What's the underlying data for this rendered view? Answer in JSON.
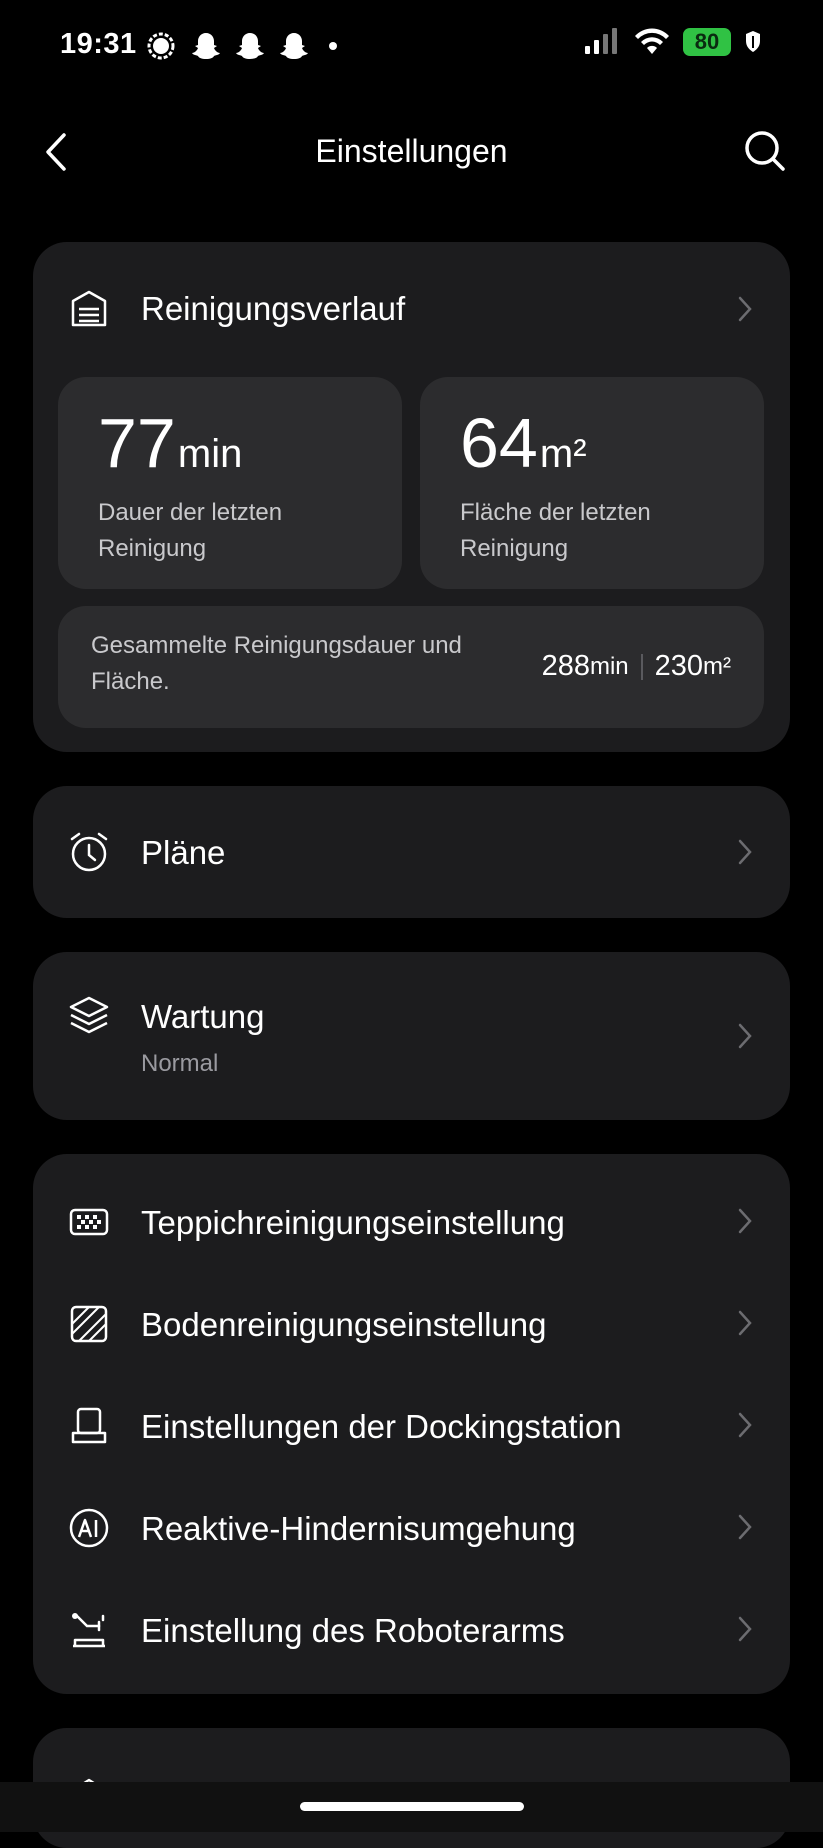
{
  "status_bar": {
    "time": "19:31",
    "battery": "80",
    "icons_left": [
      "signal-messenger-icon",
      "snapchat-icon",
      "snapchat-icon",
      "snapchat-icon",
      "dot-icon"
    ],
    "icons_right": [
      "cellular-signal-icon",
      "wifi-icon",
      "battery-icon",
      "shield-icon"
    ]
  },
  "header": {
    "title": "Einstellungen"
  },
  "history": {
    "title": "Reinigungsverlauf",
    "last_duration": {
      "value": "77",
      "unit": "min",
      "label": "Dauer der letzten Reinigung"
    },
    "last_area": {
      "value": "64",
      "unit": "m²",
      "label": "Fläche der letzten Reinigung"
    },
    "totals": {
      "label": "Gesammelte Reinigungsdauer und Fläche.",
      "duration_value": "288",
      "duration_unit": "min",
      "area_value": "230",
      "area_unit": "m²"
    }
  },
  "plans": {
    "title": "Pläne"
  },
  "maintenance": {
    "title": "Wartung",
    "status": "Normal"
  },
  "settings_list": [
    {
      "label": "Teppichreinigungseinstellung",
      "icon": "carpet-icon"
    },
    {
      "label": "Bodenreinigungseinstellung",
      "icon": "floor-icon"
    },
    {
      "label": "Einstellungen der Dockingstation",
      "icon": "dock-icon"
    },
    {
      "label": "Reaktive-Hindernisumgehung",
      "icon": "ai-icon"
    },
    {
      "label": "Einstellung des Roboterarms",
      "icon": "robot-arm-icon"
    }
  ],
  "colors": {
    "background": "#000000",
    "card": "#1c1c1e",
    "tile": "#2c2c2e",
    "battery": "#30c244"
  }
}
